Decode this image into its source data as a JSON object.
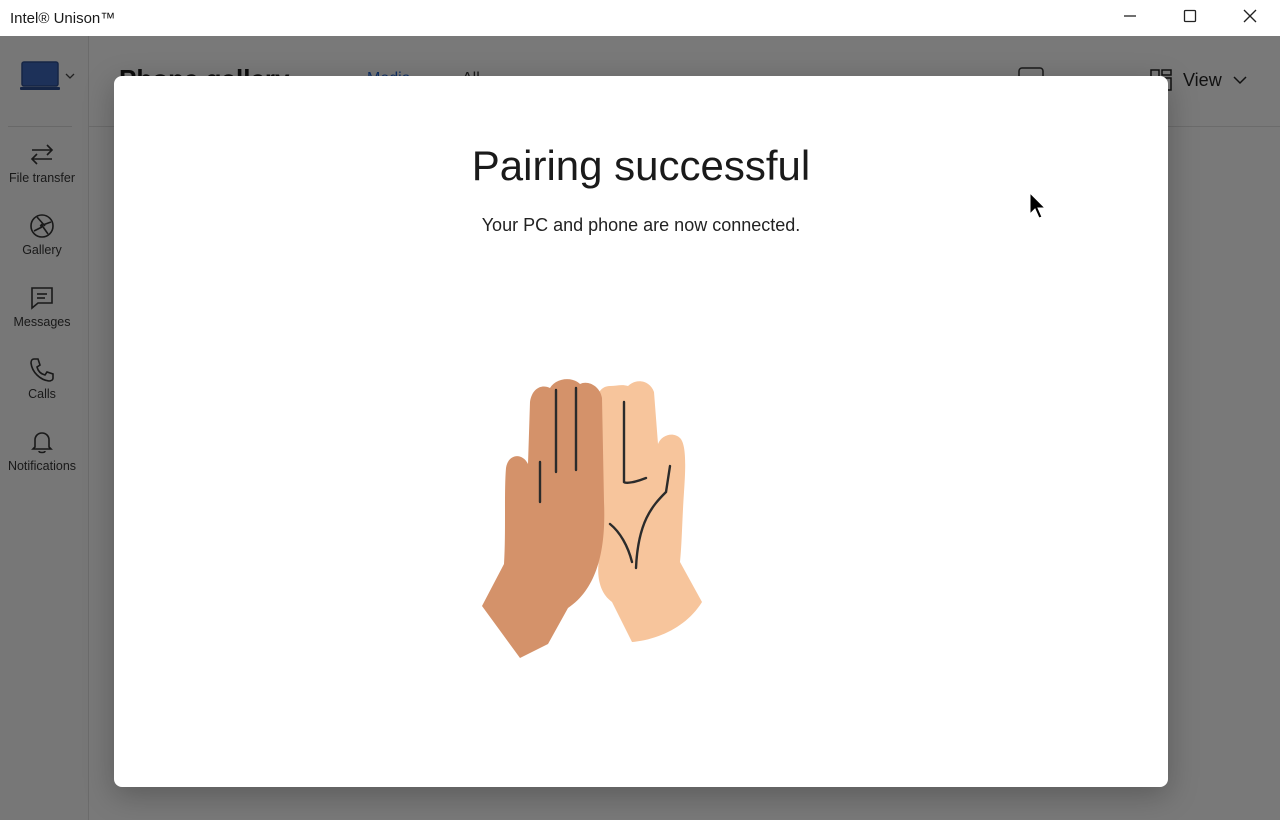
{
  "window": {
    "title": "Intel® Unison™",
    "controls": [
      "minimize-icon",
      "maximize-icon",
      "close-icon"
    ]
  },
  "sidebar": {
    "device_icon": "laptop-icon",
    "items": [
      {
        "label": "File transfer",
        "icon": "transfer-arrows-icon"
      },
      {
        "label": "Gallery",
        "icon": "gallery-aperture-icon"
      },
      {
        "label": "Messages",
        "icon": "message-icon"
      },
      {
        "label": "Calls",
        "icon": "phone-icon"
      },
      {
        "label": "Notifications",
        "icon": "bell-icon"
      }
    ]
  },
  "header": {
    "title": "Phone gallery",
    "tabs": [
      "Media",
      "All"
    ],
    "view_label": "View"
  },
  "dialog": {
    "title": "Pairing successful",
    "subtitle": "Your PC and phone are now connected.",
    "illustration": "high-five-hands-illustration"
  },
  "colors": {
    "overlay": "#000000",
    "accent": "#1f5fc9",
    "hand_dark": "#d4926a",
    "hand_light": "#f7c59c",
    "laptop_icon": "#3a63b3"
  }
}
